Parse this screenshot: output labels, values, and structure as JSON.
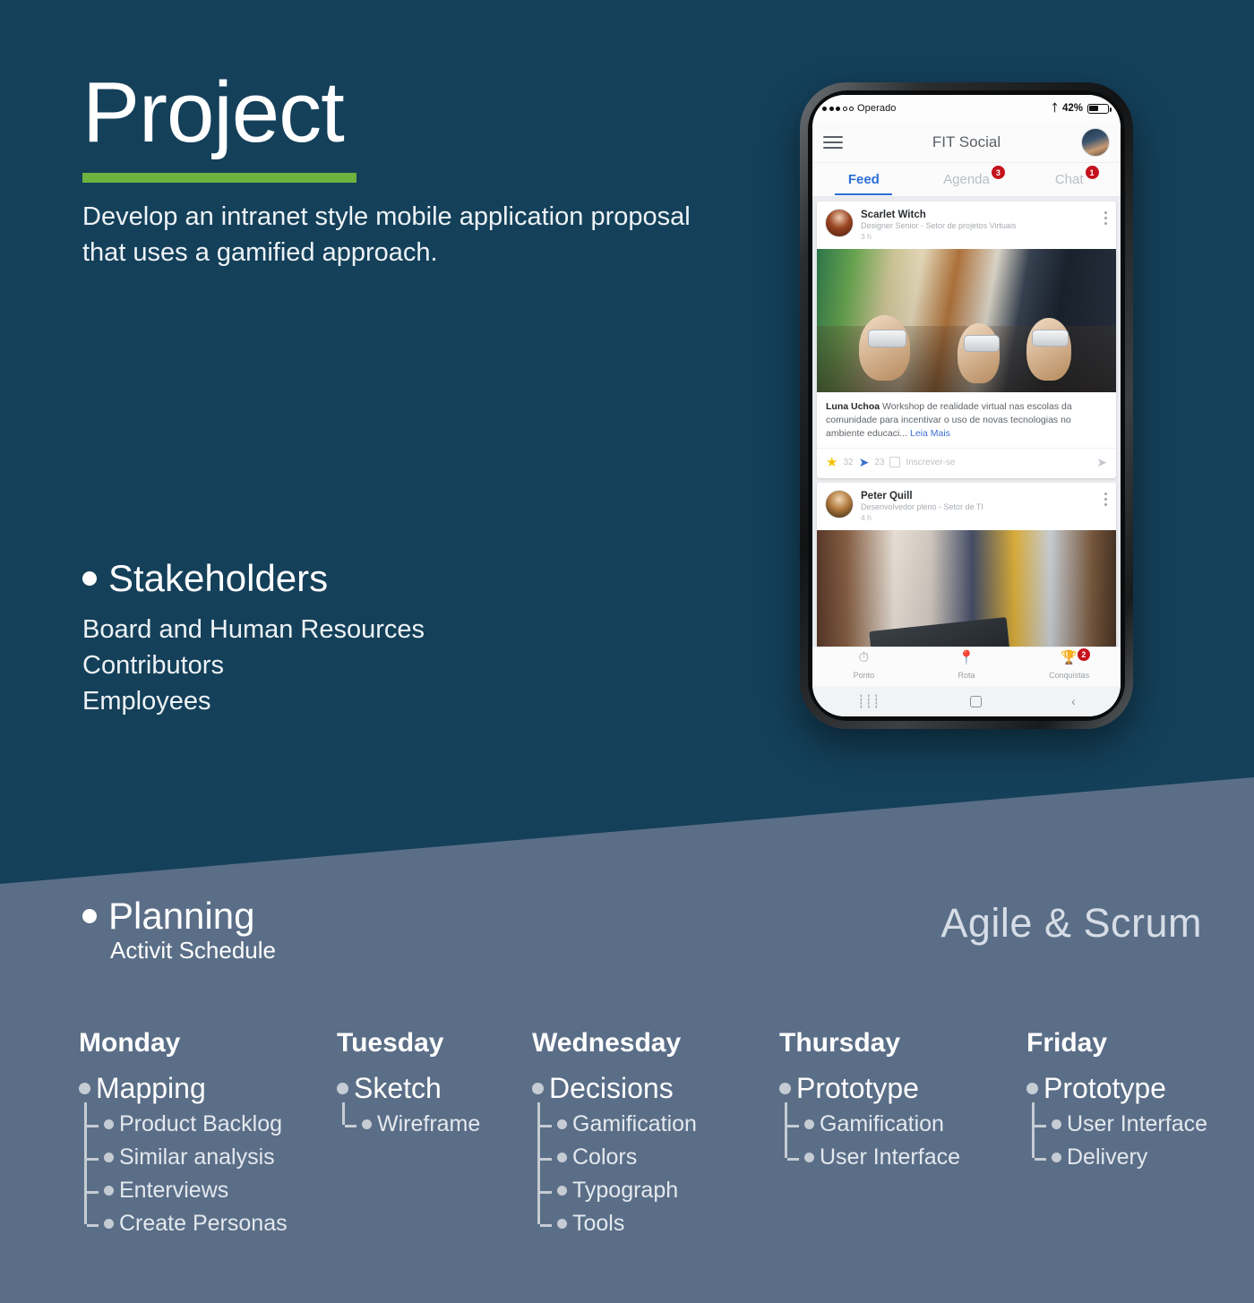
{
  "colors": {
    "dark_navy": "#14405a",
    "slate_blue": "#5b6e87",
    "accent_green": "#6cb33f",
    "fab_green": "#36a853",
    "badge_red": "#c5121c",
    "tab_blue": "#2a6fd6"
  },
  "hero": {
    "title": "Project",
    "description": "Develop an intranet style mobile application proposal that uses a gamified approach."
  },
  "stakeholders": {
    "heading": "Stakeholders",
    "items": [
      "Board and Human Resources",
      "Contributors",
      "Employees"
    ]
  },
  "planning": {
    "heading": "Planning",
    "subtitle": "Activit Schedule",
    "methodology": "Agile & Scrum",
    "days": [
      {
        "name": "Monday",
        "main": "Mapping",
        "subtasks": [
          "Product Backlog",
          "Similar analysis",
          "Enterviews",
          "Create Personas"
        ]
      },
      {
        "name": "Tuesday",
        "main": "Sketch",
        "subtasks": [
          "Wireframe"
        ]
      },
      {
        "name": "Wednesday",
        "main": "Decisions",
        "subtasks": [
          "Gamification",
          "Colors",
          "Typograph",
          "Tools"
        ]
      },
      {
        "name": "Thursday",
        "main": "Prototype",
        "subtasks": [
          "Gamification",
          "User Interface"
        ]
      },
      {
        "name": "Friday",
        "main": "Prototype",
        "subtasks": [
          "User Interface",
          "Delivery"
        ]
      }
    ]
  },
  "phone": {
    "status_bar": {
      "carrier": "Operado",
      "bluetooth_icon": "bluetooth-icon",
      "battery_percent": "42%"
    },
    "app_bar": {
      "menu_icon": "hamburger-menu-icon",
      "title": "FIT Social",
      "avatar": "user-avatar"
    },
    "tabs": [
      {
        "label": "Feed",
        "badge": "",
        "active": true
      },
      {
        "label": "Agenda",
        "badge": "3",
        "active": false
      },
      {
        "label": "Chat",
        "badge": "1",
        "active": false
      }
    ],
    "posts": [
      {
        "author": "Scarlet Witch",
        "role": "Designer Senior - Setor de projetos Virtuais",
        "time": "3 h",
        "caption_author": "Luna Uchoa",
        "caption": "Workshop de realidade virtual nas escolas da comunidade para incentivar o uso de novas tecnologias no ambiente educaci...",
        "read_more": "Leia Mais",
        "star_count": "32",
        "share_count": "23",
        "subscribe_label": "Inscrever-se"
      },
      {
        "author": "Peter Quill",
        "role": "Desenvolvedor pleno - Setor de TI",
        "time": "4 h"
      }
    ],
    "fab_label": "+",
    "bottom_nav": [
      {
        "label": "Ponto",
        "icon": "clock-icon",
        "badge": ""
      },
      {
        "label": "Rota",
        "icon": "map-pin-icon",
        "badge": ""
      },
      {
        "label": "Conquistas",
        "icon": "trophy-icon",
        "badge": "2"
      }
    ]
  }
}
